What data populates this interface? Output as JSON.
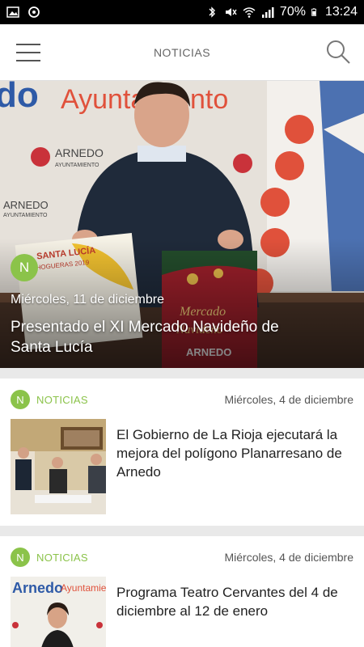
{
  "status_bar": {
    "battery": "70%",
    "time": "13:24",
    "icons": [
      "image-icon",
      "sync-icon",
      "bluetooth-icon",
      "mute-icon",
      "wifi-icon",
      "signal-icon",
      "battery-icon"
    ]
  },
  "header": {
    "title": "NOTICIAS",
    "menu_icon": "hamburger-menu-icon",
    "search_icon": "search-icon"
  },
  "hero": {
    "badge": "N",
    "date": "Miércoles, 11 de diciembre",
    "title": "Presentado el XI Mercado Navideño de Santa Lucía",
    "bg_text": "Ayuntamiento",
    "bg_word": "do",
    "poster_left_title": "SANTA LUCÍA",
    "poster_left_sub": "HOGUERAS 2019",
    "poster_right_title": "Mercado Navideño",
    "poster_right_city": "ARNEDO",
    "logo_text": "ARNEDO",
    "logo_sub": "AYUNTAMIENTO"
  },
  "articles": [
    {
      "badge": "N",
      "category": "NOTICIAS",
      "date": "Miércoles, 4 de diciembre",
      "title": "El Gobierno de La Rioja ejecutará la mejora del polígono Planarresano de Arnedo"
    },
    {
      "badge": "N",
      "category": "NOTICIAS",
      "date": "Miércoles, 4 de diciembre",
      "title": "Programa Teatro Cervantes del 4 de diciembre al 12 de enero",
      "thumb_text": "Arnedo",
      "thumb_text2": "Ayuntamie"
    }
  ],
  "colors": {
    "accent": "#8bc34a",
    "header_bg": "#ffffff",
    "status_bg": "#000000"
  }
}
